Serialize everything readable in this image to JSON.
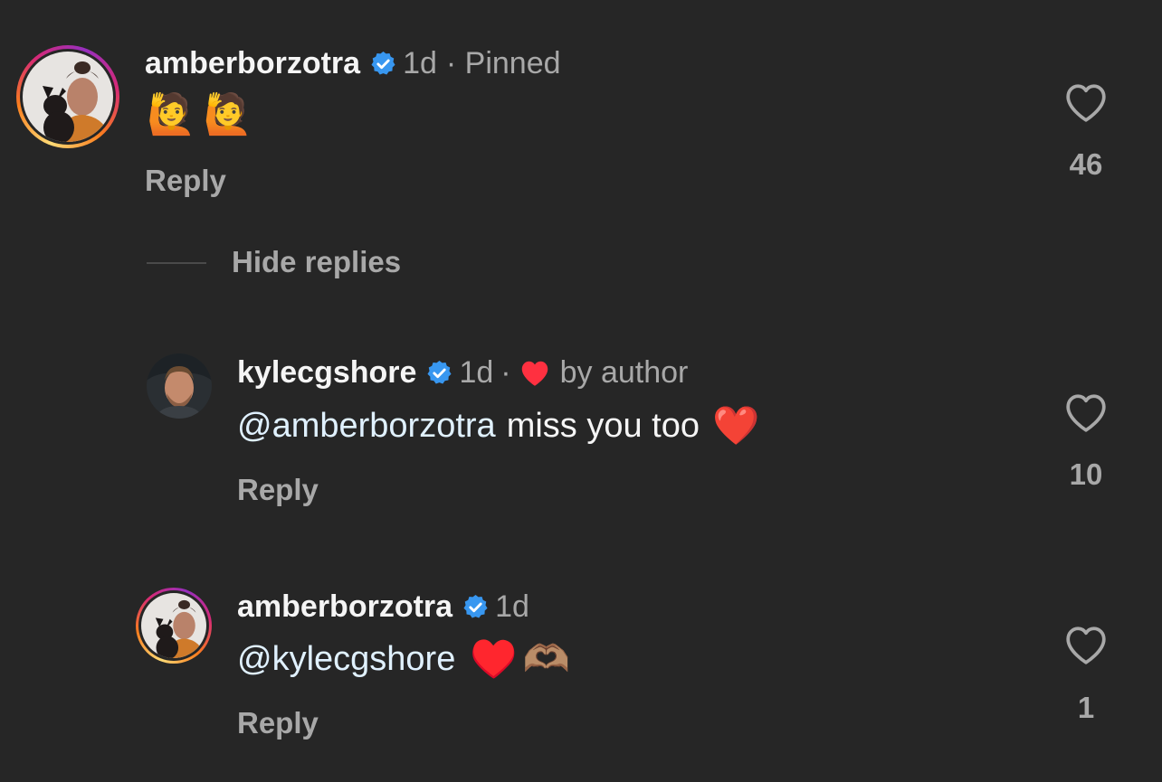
{
  "comments": [
    {
      "username": "amberborzotra",
      "time": "1d",
      "meta_suffix": "· Pinned",
      "text_emoji": "🙋🙋",
      "reply_label": "Reply",
      "like_count": "46"
    },
    {
      "username": "kylecgshore",
      "time": "1d",
      "meta_dot": "·",
      "liked_by_author_label": "by author",
      "mention": "@amberborzotra",
      "text": "miss you too",
      "text_emoji": "❤️",
      "reply_label": "Reply",
      "like_count": "10"
    },
    {
      "username": "amberborzotra",
      "time": "1d",
      "mention": "@kylecgshore",
      "text_emoji": "♥️🫶🏽",
      "reply_label": "Reply",
      "like_count": "1"
    }
  ],
  "thread": {
    "hide_replies_label": "Hide replies"
  },
  "colors": {
    "background": "#262626",
    "verified_blue": "#3897f0",
    "heart_red": "#ff3040",
    "secondary_text": "#a8a8a8",
    "mention_text": "#e0f1ff"
  },
  "icons": {
    "verified": "verified-badge-icon",
    "like": "heart-outline-icon",
    "author_like": "heart-filled-icon"
  }
}
